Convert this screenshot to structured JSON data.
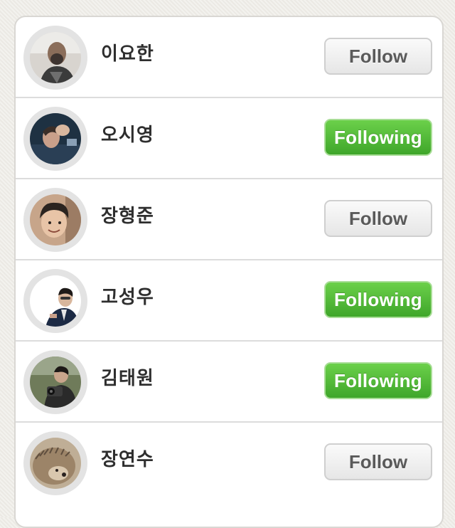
{
  "users": [
    {
      "name": "이요한",
      "button_label": "Follow",
      "state": "follow"
    },
    {
      "name": "오시영",
      "button_label": "Following",
      "state": "following"
    },
    {
      "name": "장형준",
      "button_label": "Follow",
      "state": "follow"
    },
    {
      "name": "고성우",
      "button_label": "Following",
      "state": "following"
    },
    {
      "name": "김태원",
      "button_label": "Following",
      "state": "following"
    },
    {
      "name": "장연수",
      "button_label": "Follow",
      "state": "follow"
    }
  ],
  "colors": {
    "following_green": "#4cb935",
    "follow_gray": "#eeeeee",
    "name_text": "#2e2e2e"
  }
}
